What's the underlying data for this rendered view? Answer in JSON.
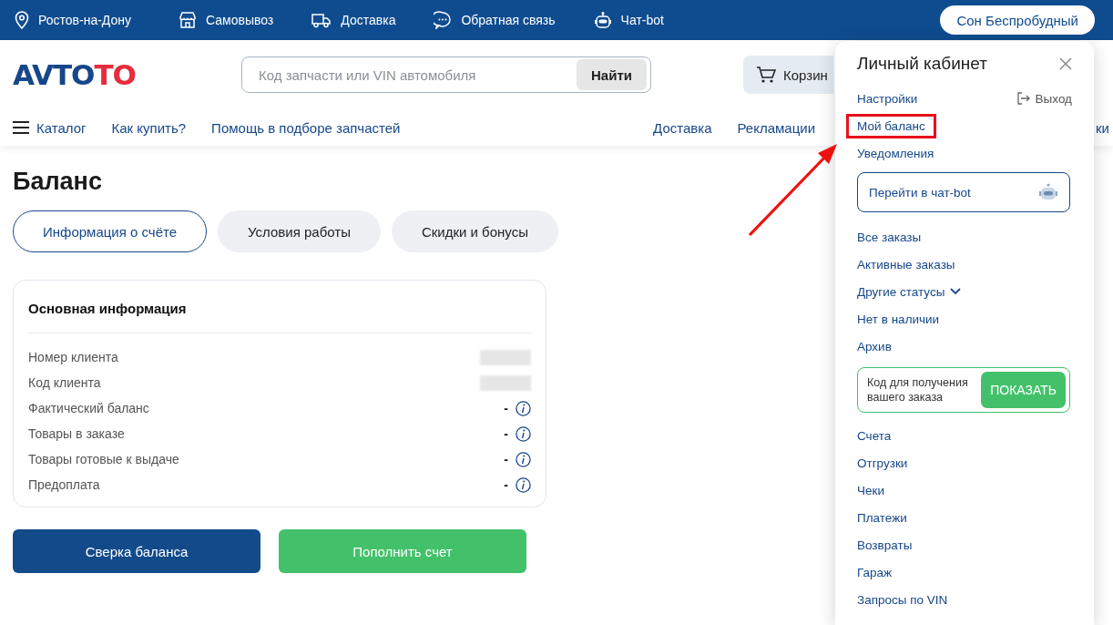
{
  "top_bar": {
    "city": "Ростов-на-Дону",
    "links": [
      {
        "kind": "pickup",
        "label": "Самовывоз"
      },
      {
        "kind": "delivery",
        "label": "Доставка"
      },
      {
        "kind": "feedback",
        "label": "Обратная связь"
      },
      {
        "kind": "bot",
        "label": "Чат-bot"
      }
    ],
    "user": "Сон Беспробудный"
  },
  "header": {
    "logo": {
      "main": "AVTO",
      "accent": "TO"
    },
    "search": {
      "placeholder": "Код запчасти или VIN автомобиля",
      "button": "Найти"
    },
    "cart": "Корзин"
  },
  "nav": {
    "catalog": "Каталог",
    "left": [
      "Как купить?",
      "Помощь в подборе запчастей"
    ],
    "right": [
      "Доставка",
      "Рекламации"
    ],
    "edge": "ки"
  },
  "page": {
    "title": "Баланс",
    "tabs": [
      {
        "label": "Информация о счёте",
        "selected": true
      },
      {
        "label": "Условия работы",
        "selected": false
      },
      {
        "label": "Скидки и бонусы",
        "selected": false
      }
    ],
    "card": {
      "title": "Основная информация",
      "rows": [
        {
          "kind": "hidden",
          "label": "Номер клиента"
        },
        {
          "kind": "hidden",
          "label": "Код клиента"
        },
        {
          "kind": "value",
          "label": "Фактический баланс",
          "value": "-"
        },
        {
          "kind": "value",
          "label": "Товары в заказе",
          "value": "-"
        },
        {
          "kind": "value",
          "label": "Товары готовые к выдаче",
          "value": "-"
        },
        {
          "kind": "value",
          "label": "Предоплата",
          "value": "-"
        }
      ]
    },
    "buttons": [
      {
        "kind": "primary",
        "label": "Сверка баланса"
      },
      {
        "kind": "success",
        "label": "Пополнить счет"
      }
    ]
  },
  "popup": {
    "title": "Личный кабинет",
    "logout": "Выход",
    "items": [
      {
        "kind": "link",
        "label": "Настройки",
        "highlighted": false
      },
      {
        "kind": "link",
        "label": "Мой баланс",
        "highlighted": true
      },
      {
        "kind": "link",
        "label": "Уведомления",
        "highlighted": false
      },
      {
        "kind": "chat",
        "label": "Перейти в чат-bot"
      },
      {
        "kind": "link",
        "label": "Все заказы",
        "highlighted": false
      },
      {
        "kind": "link",
        "label": "Активные заказы",
        "highlighted": false
      },
      {
        "kind": "dropdown",
        "label": "Другие статусы",
        "expanded": false
      },
      {
        "kind": "link",
        "label": "Нет в наличии",
        "highlighted": false
      },
      {
        "kind": "link",
        "label": "Архив",
        "highlighted": false
      },
      {
        "kind": "code",
        "label": "Код для получения вашего заказа",
        "button": "ПОКАЗАТЬ"
      },
      {
        "kind": "link",
        "label": "Счета",
        "highlighted": false
      },
      {
        "kind": "link",
        "label": "Отгрузки",
        "highlighted": false
      },
      {
        "kind": "link",
        "label": "Чеки",
        "highlighted": false
      },
      {
        "kind": "link",
        "label": "Платежи",
        "highlighted": false
      },
      {
        "kind": "link",
        "label": "Возвраты",
        "highlighted": false
      },
      {
        "kind": "link",
        "label": "Гараж",
        "highlighted": false
      },
      {
        "kind": "link",
        "label": "Запросы по VIN",
        "highlighted": false
      }
    ]
  }
}
